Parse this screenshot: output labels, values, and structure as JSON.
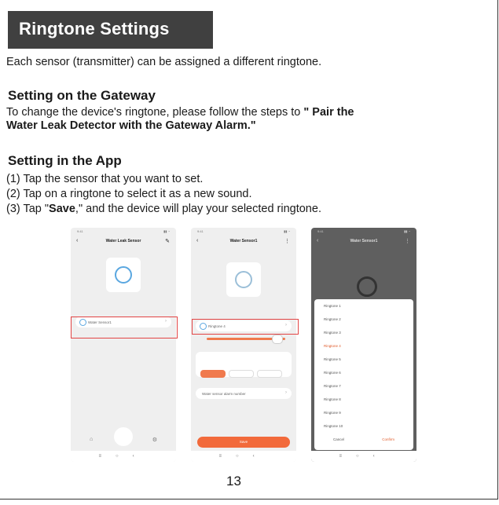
{
  "page": {
    "title": "Ringtone Settings",
    "intro": "Each sensor (transmitter) can be assigned a different ringtone.",
    "gateway_heading": "Setting on the Gateway",
    "gateway_text_1": "To change the device's ringtone, please follow the steps to ",
    "gateway_link_1": "\" Pair the",
    "gateway_link_2": "Water Leak Detector with the Gateway Alarm.\"",
    "app_heading": "Setting in the App",
    "step1": "(1) Tap the sensor that you want to set.",
    "step2": "(2) Tap on a ringtone to select it as a new sound.",
    "step3_a": "(3) Tap \"",
    "step3_b": "Save",
    "step3_c": ",\" and the device will play your selected ringtone.",
    "page_number": "13"
  },
  "phone1": {
    "nav_title": "Water Leak Sensor",
    "row_label": "Water Sensor1"
  },
  "phone2": {
    "nav_title": "Water Sensor1",
    "ringtone_label": "Ringtone 4",
    "alarm_row": "Water sensor alarm number",
    "button": "Save"
  },
  "phone3": {
    "nav_title": "Water Sensor1",
    "options": [
      "Ringtone 1",
      "Ringtone 2",
      "Ringtone 3",
      "Ringtone 4",
      "Ringtone 5",
      "Ringtone 6",
      "Ringtone 7",
      "Ringtone 8",
      "Ringtone 9",
      "Ringtone 10"
    ],
    "selected_index": 3,
    "cancel": "Cancel",
    "confirm": "Confirm"
  }
}
